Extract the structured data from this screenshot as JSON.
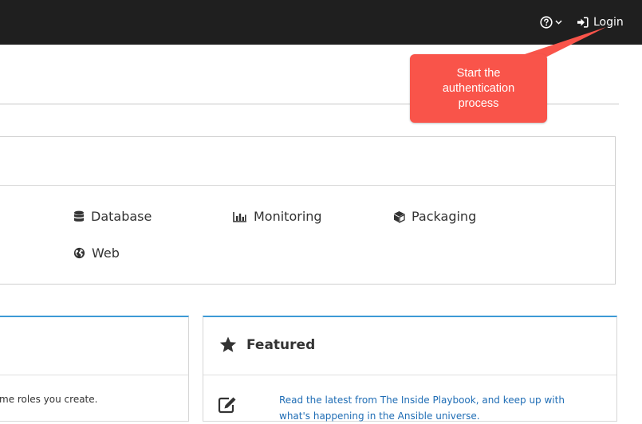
{
  "topbar": {
    "help_icon": "question-circle-icon",
    "login_icon": "sign-in-icon",
    "login_label": "Login"
  },
  "callout": {
    "text": "Start the authentication process"
  },
  "categories": {
    "items": [
      {
        "label": "Database",
        "icon": "database-icon"
      },
      {
        "label": "Monitoring",
        "icon": "bar-chart-icon"
      },
      {
        "label": "Packaging",
        "icon": "cube-icon"
      },
      {
        "label": "Web",
        "icon": "globe-icon"
      }
    ]
  },
  "left_panel": {
    "description": "me roles you create."
  },
  "featured": {
    "title": "Featured",
    "title_icon": "star-icon",
    "item_icon": "edit-icon",
    "item_text": "Read the latest from The Inside Playbook, and keep up with what's happening in the Ansible universe."
  },
  "colors": {
    "topbar": "#1f1f1f",
    "callout": "#f9544a",
    "accent": "#3d9ad6",
    "link": "#1f6db5"
  }
}
